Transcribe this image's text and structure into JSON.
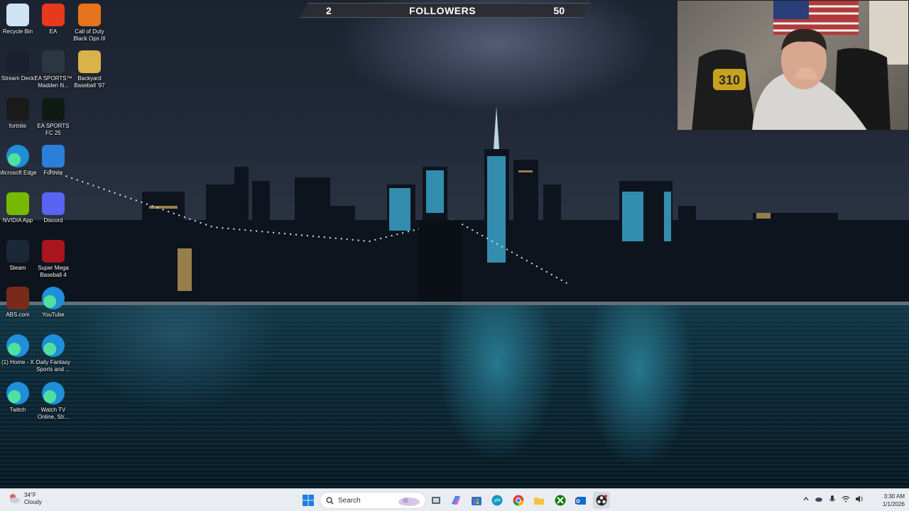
{
  "overlay": {
    "followers_current": "2",
    "followers_title": "FOLLOWERS",
    "followers_goal": "50"
  },
  "webcam": {
    "badge_text": "310"
  },
  "desktop_icons": [
    {
      "label": "Recycle Bin",
      "icon": "recycle-bin-icon",
      "color": "#cfe3f5"
    },
    {
      "label": "EA",
      "icon": "ea-icon",
      "color": "#e8381d"
    },
    {
      "label": "Call of Duty Black Ops III",
      "icon": "call-of-duty-icon",
      "color": "#e8731d"
    },
    {
      "label": "Stream Deck",
      "icon": "stream-deck-icon",
      "color": "#1b1f2e"
    },
    {
      "label": "EA SPORTS™ Madden N...",
      "icon": "madden-icon",
      "color": "#2c3640"
    },
    {
      "label": "Backyard Baseball '97",
      "icon": "backyard-baseball-icon",
      "color": "#d9b24a"
    },
    {
      "label": "fortnite",
      "icon": "epic-games-icon",
      "color": "#1a1a1a"
    },
    {
      "label": "EA SPORTS FC 25",
      "icon": "fc25-icon",
      "color": "#0e1a12"
    },
    {
      "label": "Microsoft Edge",
      "icon": "edge-icon",
      "color": "#1e8fd8"
    },
    {
      "label": "Fortnite",
      "icon": "fortnite-icon",
      "color": "#2a7fd9"
    },
    {
      "label": "NVIDIA App",
      "icon": "nvidia-icon",
      "color": "#76b900"
    },
    {
      "label": "Discord",
      "icon": "discord-icon",
      "color": "#5865f2"
    },
    {
      "label": "Steam",
      "icon": "steam-icon",
      "color": "#1b2838"
    },
    {
      "label": "Super Mega Baseball 4",
      "icon": "smb4-icon",
      "color": "#a8151c"
    },
    {
      "label": "ABS.com",
      "icon": "abs-icon",
      "color": "#7a2a1a"
    },
    {
      "label": "YouTube",
      "icon": "youtube-edge-icon",
      "color": "#1e8fd8"
    },
    {
      "label": "(1) Home - X",
      "icon": "x-edge-icon",
      "color": "#1e8fd8"
    },
    {
      "label": "Daily Fantasy Sports and ...",
      "icon": "fantasy-edge-icon",
      "color": "#1e8fd8"
    },
    {
      "label": "Twitch",
      "icon": "twitch-edge-icon",
      "color": "#1e8fd8"
    },
    {
      "label": "Watch TV Online, Str...",
      "icon": "watch-tv-edge-icon",
      "color": "#1e8fd8"
    }
  ],
  "taskbar": {
    "weather_temp": "34°F",
    "weather_cond": "Cloudy",
    "search_label": "Search",
    "time": "3:30 AM",
    "date": "1/1/2026"
  }
}
